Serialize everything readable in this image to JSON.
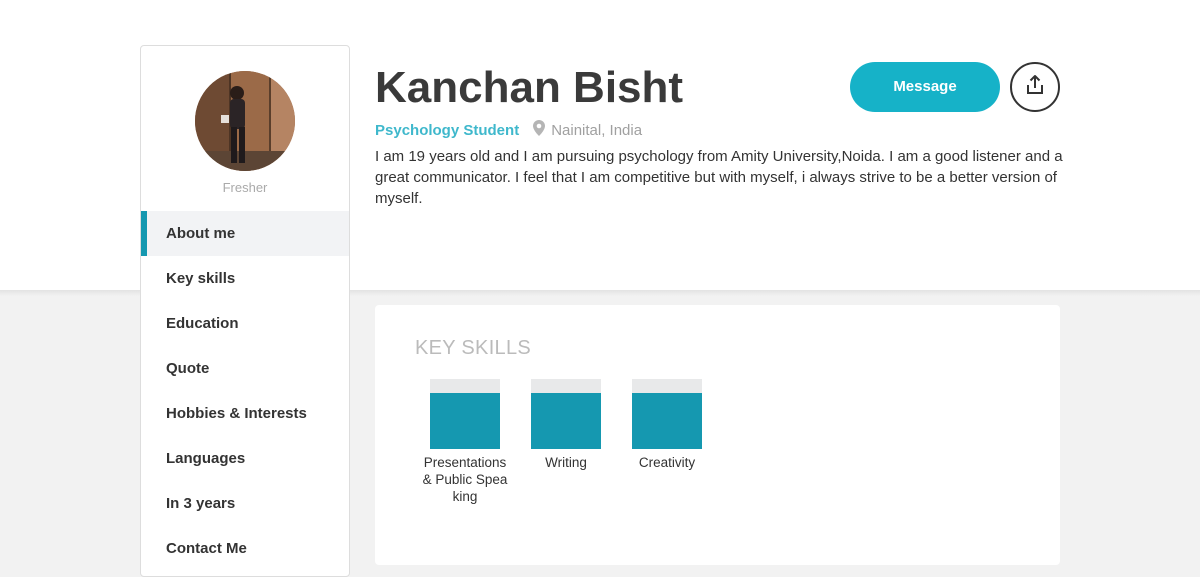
{
  "profile": {
    "name": "Kanchan Bisht",
    "role": "Psychology Student",
    "location": "Nainital, India",
    "status": "Fresher",
    "bio": "I am 19 years old and I am pursuing psychology from Amity University,Noida. I am a good listener and a great communicator. I feel that I am competitive but with myself, i always strive to be a better version of myself."
  },
  "actions": {
    "message_label": "Message",
    "share_icon": "share-upload-icon"
  },
  "sidebar": {
    "items": [
      {
        "label": "About me",
        "active": true
      },
      {
        "label": "Key skills",
        "active": false
      },
      {
        "label": "Education",
        "active": false
      },
      {
        "label": "Quote",
        "active": false
      },
      {
        "label": "Hobbies & Interests",
        "active": false
      },
      {
        "label": "Languages",
        "active": false
      },
      {
        "label": "In 3 years",
        "active": false
      },
      {
        "label": "Contact Me",
        "active": false
      }
    ]
  },
  "skills": {
    "title": "KEY SKILLS",
    "items": [
      {
        "label": "Presentations & Public Speaking",
        "level": 0.8
      },
      {
        "label": "Writing",
        "level": 0.8
      },
      {
        "label": "Creativity",
        "level": 0.8
      }
    ]
  },
  "colors": {
    "accent": "#16b2c8",
    "skill_fill": "#1598b0",
    "role_text": "#3fb8cc"
  }
}
